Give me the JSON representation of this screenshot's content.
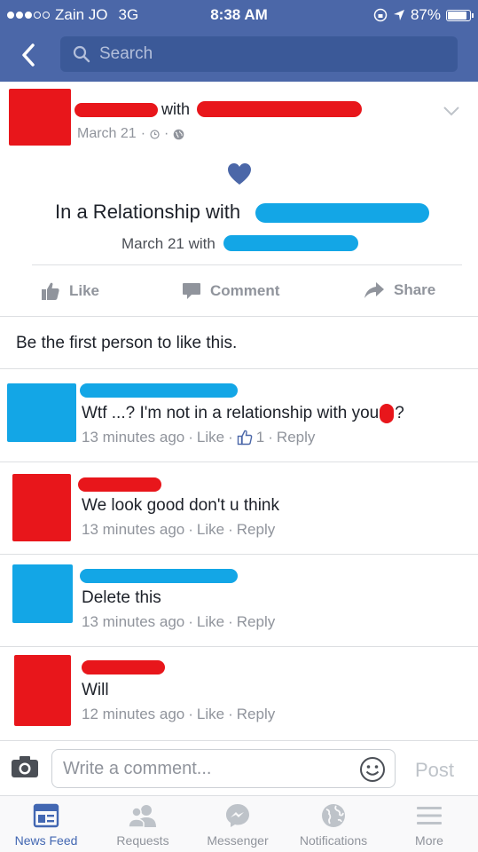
{
  "status_bar": {
    "carrier": "Zain JO",
    "network": "3G",
    "time": "8:38 AM",
    "battery": "87%"
  },
  "navbar": {
    "search_placeholder": "Search"
  },
  "post": {
    "with_label": "with",
    "date": "March 21",
    "event_title": "In a Relationship with",
    "event_date": "March 21 with"
  },
  "actions": {
    "like": "Like",
    "comment": "Comment",
    "share": "Share"
  },
  "first_like": "Be the first person to like this.",
  "comments": [
    {
      "text": "Wtf ...? I'm not in a relationship with you",
      "suffix": "?",
      "time": "13 minutes ago",
      "like": "Like",
      "likes": "1",
      "reply": "Reply"
    },
    {
      "text": "We look good don't u think",
      "time": "13 minutes ago",
      "like": "Like",
      "reply": "Reply"
    },
    {
      "text": "Delete this",
      "time": "13 minutes ago",
      "like": "Like",
      "reply": "Reply"
    },
    {
      "text": "Will",
      "time": "12 minutes ago",
      "like": "Like",
      "reply": "Reply"
    }
  ],
  "write_comment": {
    "placeholder": "Write a comment...",
    "post": "Post"
  },
  "tabs": [
    {
      "label": "News Feed",
      "icon": "news-feed-icon",
      "active": true
    },
    {
      "label": "Requests",
      "icon": "requests-icon"
    },
    {
      "label": "Messenger",
      "icon": "messenger-icon"
    },
    {
      "label": "Notifications",
      "icon": "globe-icon"
    },
    {
      "label": "More",
      "icon": "menu-icon"
    }
  ],
  "colors": {
    "brand": "#4b67a8",
    "redaction_red": "#e8161b",
    "redaction_blue": "#13a6e6"
  }
}
